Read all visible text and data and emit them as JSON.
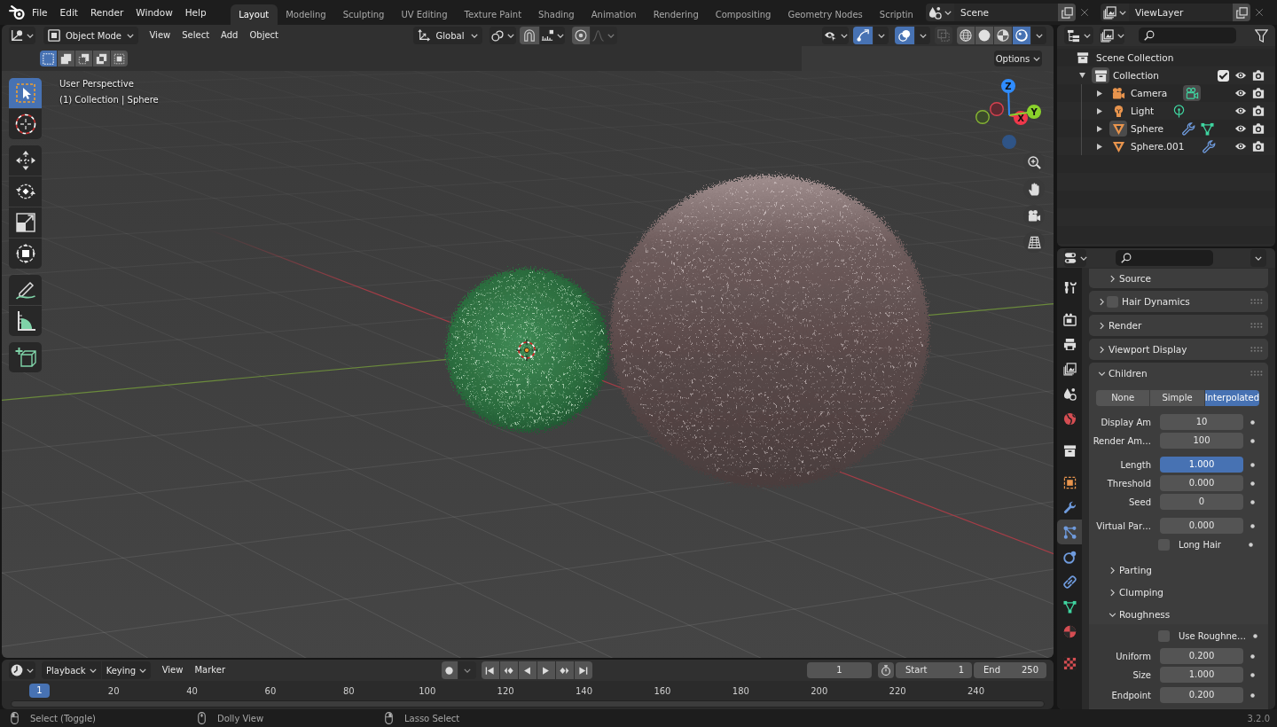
{
  "topbar": {
    "menus": [
      "File",
      "Edit",
      "Render",
      "Window",
      "Help"
    ],
    "workspaces": [
      {
        "label": "Layout",
        "selected": true
      },
      {
        "label": "Modeling",
        "selected": false
      },
      {
        "label": "Sculpting",
        "selected": false
      },
      {
        "label": "UV Editing",
        "selected": false
      },
      {
        "label": "Texture Paint",
        "selected": false
      },
      {
        "label": "Shading",
        "selected": false
      },
      {
        "label": "Animation",
        "selected": false
      },
      {
        "label": "Rendering",
        "selected": false
      },
      {
        "label": "Compositing",
        "selected": false
      },
      {
        "label": "Geometry Nodes",
        "selected": false
      },
      {
        "label": "Scriptin",
        "selected": false
      }
    ],
    "scene": "Scene",
    "view_layer": "ViewLayer"
  },
  "viewport": {
    "mode": "Object Mode",
    "menus": [
      "View",
      "Select",
      "Add",
      "Object"
    ],
    "orientation": "Global",
    "snapping": false,
    "proportional_editing": false,
    "gizmos": true,
    "overlays": true,
    "xray": false,
    "shading": [
      {
        "selected": false
      },
      {
        "selected": false
      },
      {
        "selected": false
      },
      {
        "selected": true
      }
    ],
    "select_modes": [
      {
        "selected": true
      },
      {
        "selected": false
      },
      {
        "selected": false
      },
      {
        "selected": false
      },
      {
        "selected": false
      }
    ],
    "options": "Options",
    "info": [
      "User Perspective",
      "(1) Collection | Sphere"
    ],
    "tools": [
      {
        "selected": true
      },
      {
        "selected": false
      },
      {
        "selected": false
      },
      {
        "selected": false
      },
      {
        "selected": false
      },
      {
        "selected": false
      },
      {
        "selected": false
      },
      {
        "selected": false
      },
      {
        "selected": false
      }
    ],
    "axis_labels": [
      "X",
      "Y",
      "Z"
    ]
  },
  "timeline": {
    "menus": [
      {
        "label": "Playback",
        "kind": "dropdown"
      },
      {
        "label": "Keying",
        "kind": "dropdown"
      },
      {
        "label": "View",
        "kind": "menu"
      },
      {
        "label": "Marker",
        "kind": "menu"
      }
    ],
    "auto_keying": false,
    "current_frame": "1",
    "start_label": "Start",
    "start": "1",
    "end_label": "End",
    "end": "250",
    "ruler": {
      "frame": "1",
      "ticks": [
        "20",
        "40",
        "60",
        "80",
        "100",
        "120",
        "140",
        "160",
        "180",
        "200",
        "220",
        "240"
      ]
    }
  },
  "status_bar": {
    "hints": [
      "Select (Toggle)",
      "Dolly View",
      "Lasso Select"
    ],
    "version": "3.2.0"
  },
  "outliner": {
    "root": "Scene Collection",
    "items": [
      {
        "kind": "collection",
        "name": "Collection",
        "expanded": true,
        "active": true,
        "checked": true,
        "visible": true,
        "renderable": true,
        "children": [
          {
            "kind": "camera",
            "name": "Camera",
            "expanded": false,
            "active": false,
            "visible": true,
            "renderable": true,
            "data": [
              {
                "kind": "camera",
                "active": true
              }
            ]
          },
          {
            "kind": "light",
            "name": "Light",
            "expanded": false,
            "active": false,
            "visible": true,
            "renderable": true,
            "data": [
              {
                "kind": "light",
                "active": false
              }
            ]
          },
          {
            "kind": "mesh",
            "name": "Sphere",
            "expanded": false,
            "active": true,
            "visible": true,
            "renderable": true,
            "data": [
              {
                "kind": "modifier",
                "active": false
              },
              {
                "kind": "mesh",
                "active": false
              }
            ]
          },
          {
            "kind": "mesh",
            "name": "Sphere.001",
            "expanded": false,
            "active": false,
            "visible": true,
            "renderable": true,
            "data": [
              {
                "kind": "modifier",
                "active": false
              }
            ]
          }
        ]
      }
    ]
  },
  "properties": {
    "tabs": [
      {
        "selected": false
      },
      {
        "selected": false
      },
      {
        "selected": false
      },
      {
        "selected": false
      },
      {
        "selected": false
      },
      {
        "selected": false
      },
      {
        "selected": false
      },
      {
        "selected": false
      },
      {
        "selected": false
      },
      {
        "selected": true
      },
      {
        "selected": false
      },
      {
        "selected": false
      },
      {
        "selected": false
      },
      {
        "selected": false
      },
      {
        "selected": false
      }
    ],
    "panels": [
      {
        "kind": "subpanel",
        "title": "Source",
        "expanded": false
      },
      {
        "kind": "panel",
        "title": "Hair Dynamics",
        "expanded": false,
        "checked": false
      },
      {
        "kind": "panel",
        "title": "Render",
        "expanded": false
      },
      {
        "kind": "panel",
        "title": "Viewport Display",
        "expanded": false
      },
      {
        "kind": "panel",
        "title": "Children",
        "expanded": true,
        "groups": [
          [
            {
              "kind": "enum",
              "options": [
                {
                  "label": "None",
                  "selected": false
                },
                {
                  "label": "Simple",
                  "selected": false
                },
                {
                  "label": "Interpolated",
                  "selected": true
                }
              ]
            }
          ],
          [
            {
              "kind": "number",
              "label": "Display Am",
              "value": "10",
              "active": false
            },
            {
              "kind": "number",
              "label": "Render Am…",
              "value": "100",
              "active": false
            }
          ],
          [
            {
              "kind": "number",
              "label": "Length",
              "value": "1.000",
              "active": true
            },
            {
              "kind": "number",
              "label": "Threshold",
              "value": "0.000",
              "active": false
            },
            {
              "kind": "number",
              "label": "Seed",
              "value": "0",
              "active": false
            }
          ],
          [
            {
              "kind": "number",
              "label": "Virtual Par…",
              "value": "0.000",
              "active": false
            },
            {
              "kind": "checkbox",
              "label": "Long Hair",
              "checked": false
            }
          ],
          [
            {
              "kind": "subpanel",
              "title": "Parting",
              "expanded": false
            },
            {
              "kind": "subpanel",
              "title": "Clumping",
              "expanded": false
            },
            {
              "kind": "subpanel",
              "title": "Roughness",
              "expanded": true,
              "groups": [
                [
                  {
                    "kind": "checkbox",
                    "label": "Use Roughne…",
                    "checked": false
                  }
                ],
                [
                  {
                    "kind": "number",
                    "label": "Uniform",
                    "value": "0.200",
                    "active": false
                  },
                  {
                    "kind": "number",
                    "label": "Size",
                    "value": "1.000",
                    "active": false
                  }
                ],
                [
                  {
                    "kind": "number",
                    "label": "Endpoint",
                    "value": "0.200",
                    "active": false
                  }
                ]
              ]
            }
          ]
        ]
      }
    ]
  }
}
